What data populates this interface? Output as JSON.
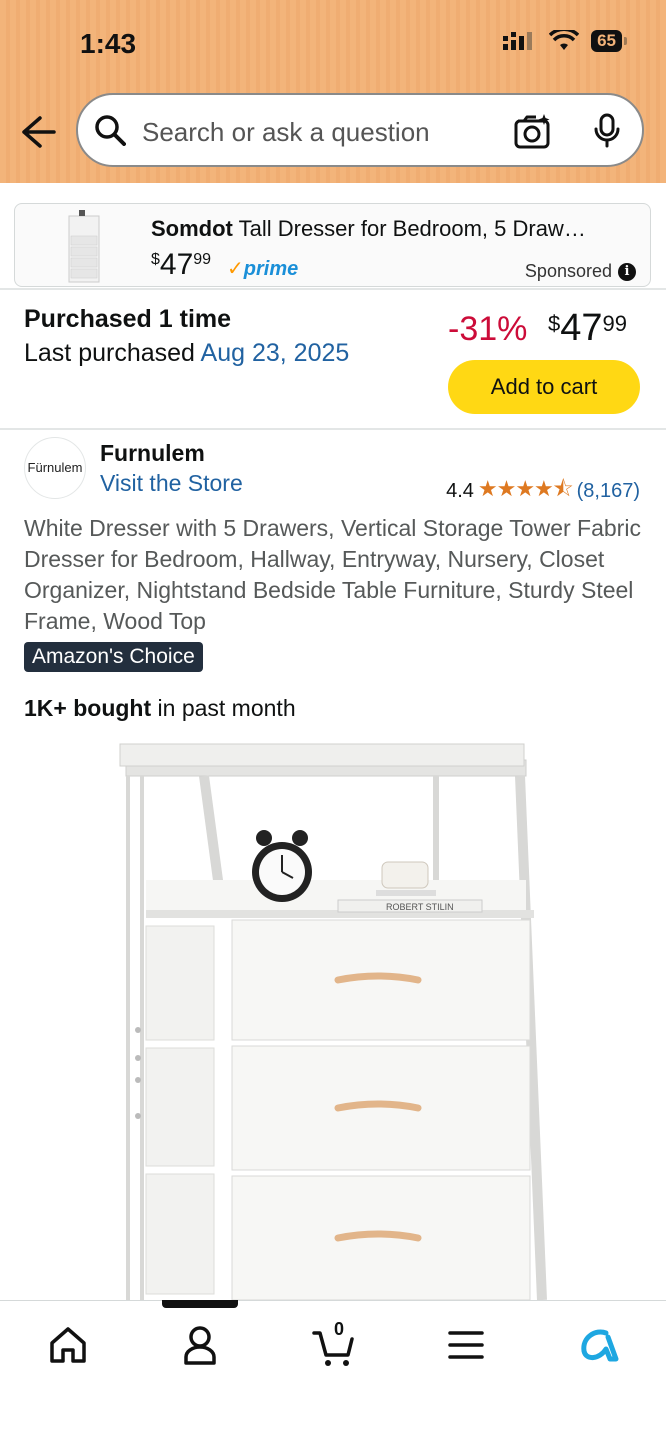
{
  "status_bar": {
    "time": "1:43",
    "battery": "65"
  },
  "search": {
    "placeholder": "Search or ask a question"
  },
  "sponsored_card": {
    "brand": "Somdot",
    "title": "Tall Dresser for Bedroom, 5 Draw…",
    "price_dollar": "$",
    "price_whole": "47",
    "price_cents": "99",
    "prime": "prime",
    "label": "Sponsored"
  },
  "purchase": {
    "title": "Purchased 1 time",
    "last_label": "Last purchased",
    "last_date": "Aug 23, 2025",
    "discount": "-31%",
    "price_dollar": "$",
    "price_whole": "47",
    "price_cents": "99",
    "add_to_cart": "Add to cart"
  },
  "store": {
    "logo_text": "Fürnulem",
    "brand": "Furnulem",
    "visit": "Visit the Store",
    "rating": "4.4",
    "stars": "★★★★⯪",
    "review_count": "(8,167)"
  },
  "product": {
    "description": "White Dresser with 5 Drawers, Vertical Storage Tower Fabric Dresser for Bedroom, Hallway, Entryway, Nursery, Closet Organizer, Nightstand Bedside Table Furniture, Sturdy Steel Frame, Wood Top",
    "badge": "Amazon's Choice",
    "bought_bold": "1K+ bought",
    "bought_rest": " in past month",
    "book_label": "ROBERT STILIN"
  },
  "bottom_nav": {
    "cart_count": "0",
    "items": [
      "home-icon",
      "account-icon",
      "cart-icon",
      "menu-icon",
      "alexa-icon"
    ]
  },
  "colors": {
    "header": "#f3b47a",
    "link": "#2162a1",
    "discount": "#cc0c39",
    "add_to_cart": "#ffd814",
    "stars": "#de7921",
    "badge": "#232f3e"
  }
}
